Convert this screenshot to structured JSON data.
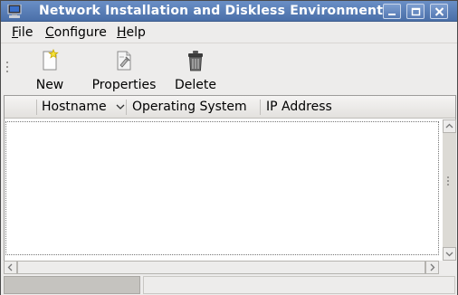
{
  "window": {
    "title": "Network Installation and Diskless Environment",
    "icon": "computer-app-icon",
    "controls": [
      "minimize-icon",
      "maximize-icon",
      "close-icon"
    ]
  },
  "menubar": {
    "file": {
      "mnemonic": "F",
      "rest": "ile"
    },
    "configure": {
      "mnemonic": "C",
      "rest": "onfigure"
    },
    "help": {
      "mnemonic": "H",
      "rest": "elp"
    }
  },
  "toolbar": {
    "new_label": "New",
    "properties_label": "Properties",
    "delete_label": "Delete"
  },
  "table": {
    "columns": [
      "Hostname",
      "Operating System",
      "IP Address"
    ],
    "sorted_column": "Hostname",
    "sort_direction": "descending",
    "rows": []
  },
  "statusbar": {
    "left_text": "",
    "right_text": ""
  },
  "colors": {
    "titlebar": "#5a7fb8",
    "window_bg": "#edeceb",
    "status_left": "#c5c3bf"
  }
}
